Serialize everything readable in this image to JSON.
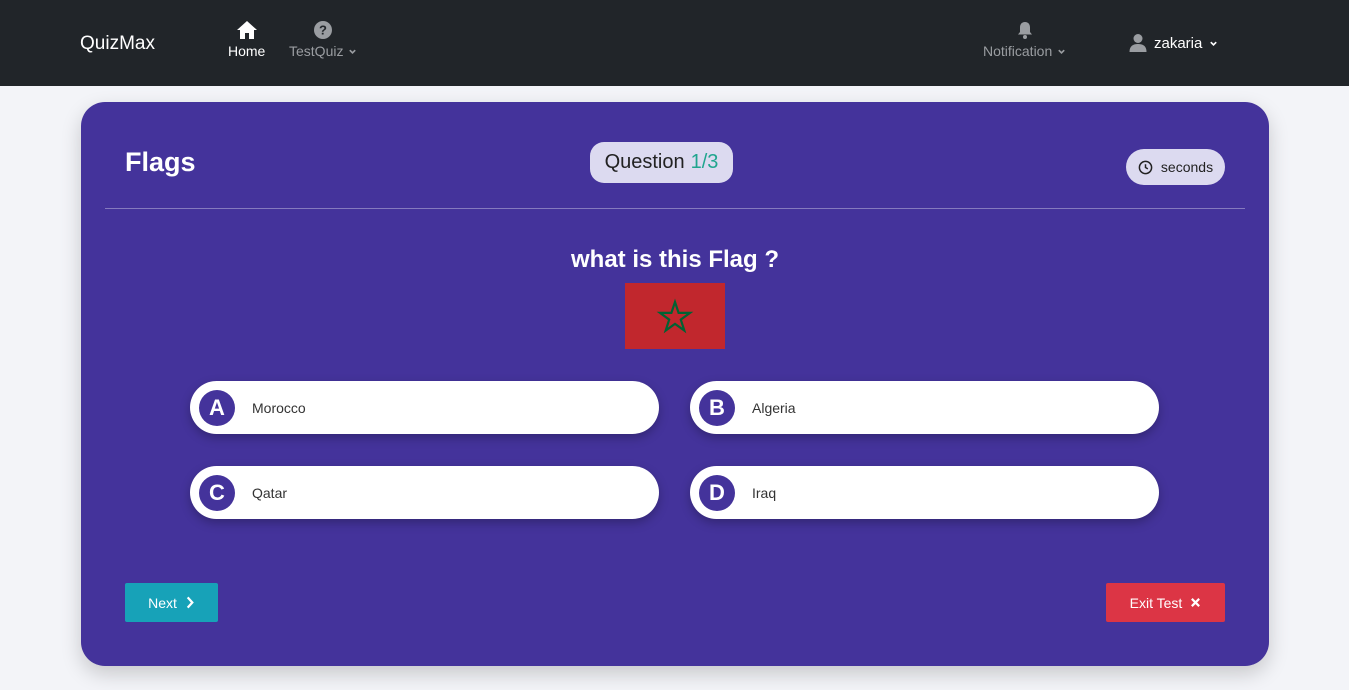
{
  "navbar": {
    "brand": "QuizMax",
    "home_label": "Home",
    "testquiz_label": "TestQuiz",
    "notification_label": "Notification",
    "user_label": "zakaria"
  },
  "quiz": {
    "title": "Flags",
    "question_word": "Question",
    "question_counter": "1/3",
    "timer_label": "seconds",
    "question_text": "what is this Flag ?",
    "flag_colors": {
      "field": "#c1272d",
      "star": "#006233"
    },
    "options": [
      {
        "letter": "A",
        "text": "Morocco"
      },
      {
        "letter": "B",
        "text": "Algeria"
      },
      {
        "letter": "C",
        "text": "Qatar"
      },
      {
        "letter": "D",
        "text": "Iraq"
      }
    ],
    "next_label": "Next",
    "exit_label": "Exit Test"
  },
  "colors": {
    "card_bg": "#44339b",
    "navbar_bg": "#212529",
    "next_btn": "#17a2b8",
    "exit_btn": "#dc3545",
    "counter_accent": "#20a58e"
  }
}
